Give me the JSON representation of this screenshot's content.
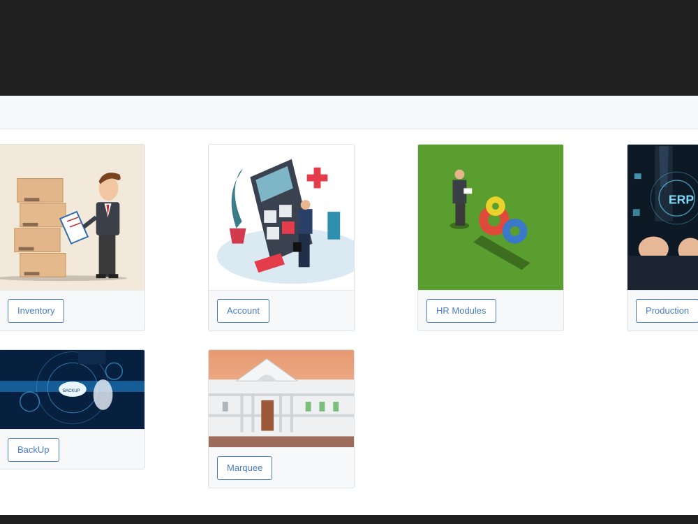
{
  "modules": [
    {
      "label": "Inventory"
    },
    {
      "label": "Account"
    },
    {
      "label": "HR Modules"
    },
    {
      "label": "Production"
    },
    {
      "label": "BackUp"
    },
    {
      "label": "Marquee"
    }
  ],
  "image_text": {
    "erp": "ERP",
    "backup": "BACKUP"
  },
  "colors": {
    "topbar": "#202020",
    "subbar": "#f7f8fa",
    "button_border": "#4a7cc5",
    "hr_background": "#5a9e2f"
  }
}
